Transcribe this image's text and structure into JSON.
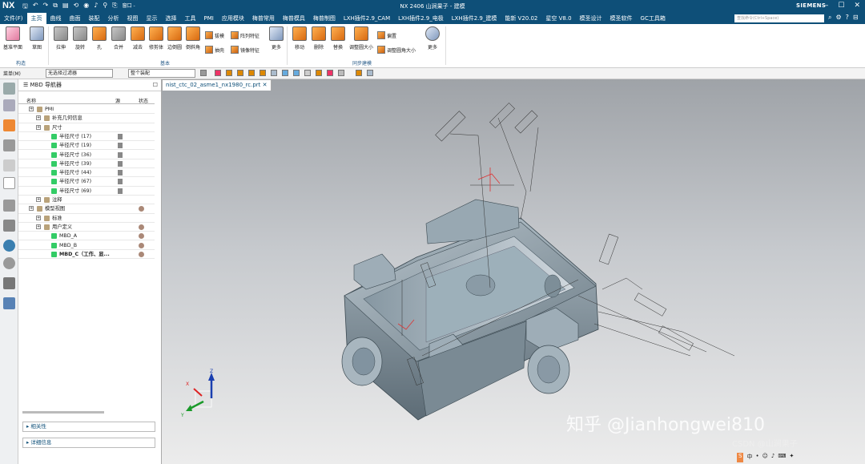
{
  "titlebar": {
    "app": "NX",
    "title": "NX 2406 山涧果子 - 建模",
    "brand": "SIEMENS",
    "window_menu": "窗口 -"
  },
  "menu": {
    "items": [
      "文件(F)",
      "主页",
      "曲线",
      "曲面",
      "装配",
      "分析",
      "视图",
      "显示",
      "选择",
      "工具",
      "PMI",
      "应用模块",
      "梅普常用",
      "梅普模具",
      "梅普制图",
      "LXH插件2.9_CAM",
      "LXH插件2.9_电极",
      "LXH插件2.9_建模",
      "能新 V20.02",
      "星空 V8.0",
      "模圣设计",
      "模圣软件",
      "GC工具箱"
    ],
    "active_index": 1,
    "search_placeholder": "查找命令(Ctrl+Space)"
  },
  "ribbon": {
    "buttons": [
      "基准平面",
      "草图",
      "拉伸",
      "旋转",
      "孔",
      "合并",
      "减去",
      "修剪体",
      "边倒圆",
      "倒斜角",
      "更多",
      "移动",
      "删除",
      "替换",
      "调整圆大小",
      "更多"
    ],
    "small": [
      "拔模",
      "阵列特征",
      "抽壳",
      "镜像特征",
      "偏置",
      "调整圆角大小"
    ],
    "groups": [
      "构造",
      "基本",
      "同步建模"
    ]
  },
  "toolbar2": {
    "menu": "菜单(M)",
    "filter": "无选择过滤器",
    "assembly": "整个装配"
  },
  "navigator": {
    "title": "MBD 导航器",
    "col_name": "名称",
    "col_source": "源",
    "col_status": "状态",
    "rows": [
      {
        "label": "PMI",
        "indent": 1
      },
      {
        "label": "补充几何信息",
        "indent": 2
      },
      {
        "label": "尺寸",
        "indent": 2
      },
      {
        "label": "半径尺寸 (17)",
        "indent": 3
      },
      {
        "label": "半径尺寸 (19)",
        "indent": 3
      },
      {
        "label": "半径尺寸 (36)",
        "indent": 3
      },
      {
        "label": "半径尺寸 (39)",
        "indent": 3
      },
      {
        "label": "半径尺寸 (44)",
        "indent": 3
      },
      {
        "label": "半径尺寸 (67)",
        "indent": 3
      },
      {
        "label": "半径尺寸 (69)",
        "indent": 3
      },
      {
        "label": "注释",
        "indent": 2
      },
      {
        "label": "模型视图",
        "indent": 1
      },
      {
        "label": "标准",
        "indent": 2
      },
      {
        "label": "用户定义",
        "indent": 2
      },
      {
        "label": "MBD_A",
        "indent": 3
      },
      {
        "label": "MBD_B",
        "indent": 3
      },
      {
        "label": "MBD_C（工作、显...",
        "indent": 3
      }
    ],
    "panel_related": "相关性",
    "panel_details": "详细信息"
  },
  "viewport": {
    "tab": "nist_ctc_02_asme1_nx1980_rc.prt",
    "watermark": "知乎 @Jianhongwei810",
    "watermark2": "CSDN @山涧果子"
  },
  "status": {
    "ime": "中"
  },
  "colors": {
    "titlebar": "#0e4f78",
    "model": "#8fa0ab",
    "pmi": "#222222"
  }
}
